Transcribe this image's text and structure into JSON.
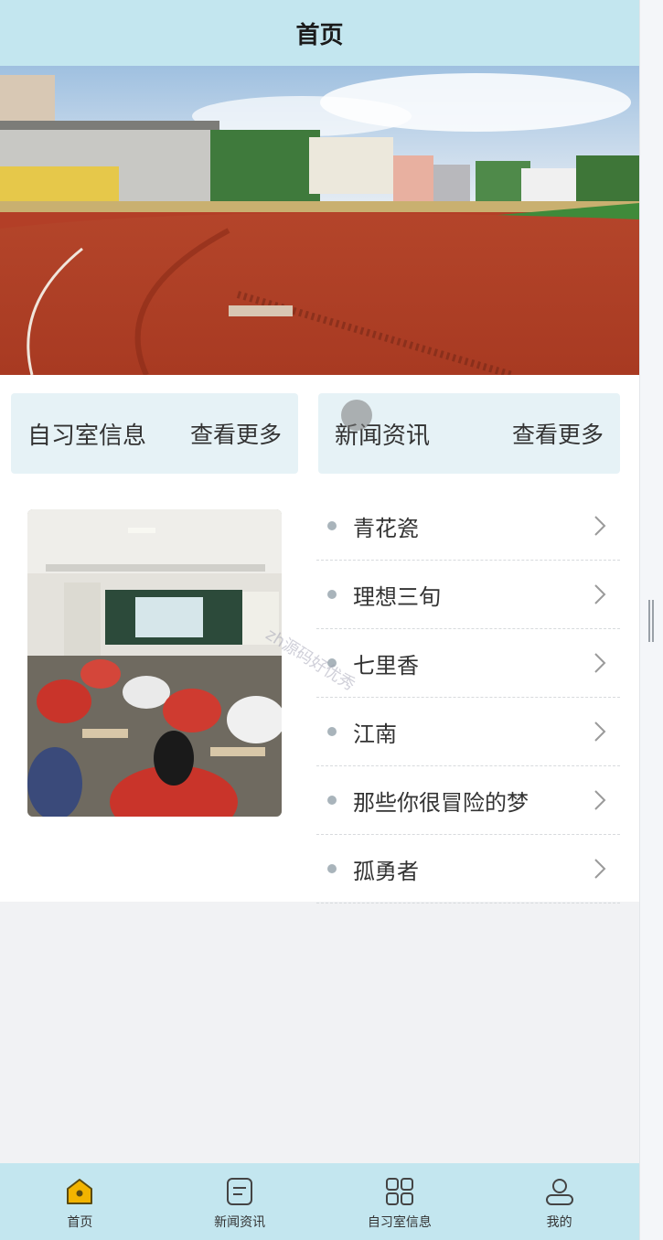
{
  "navbar": {
    "title": "首页"
  },
  "sections": {
    "study_room": {
      "title": "自习室信息",
      "more": "查看更多"
    },
    "news": {
      "title": "新闻资讯",
      "more": "查看更多"
    }
  },
  "news_items": [
    {
      "title": "青花瓷"
    },
    {
      "title": "理想三旬"
    },
    {
      "title": "七里香"
    },
    {
      "title": "江南"
    },
    {
      "title": "那些你很冒险的梦"
    },
    {
      "title": "孤勇者"
    }
  ],
  "watermark": "zh源码好优秀",
  "tabbar": {
    "items": [
      {
        "label": "首页",
        "icon": "home-icon",
        "active": true
      },
      {
        "label": "新闻资讯",
        "icon": "news-icon",
        "active": false
      },
      {
        "label": "自习室信息",
        "icon": "grid-icon",
        "active": false
      },
      {
        "label": "我的",
        "icon": "user-icon",
        "active": false
      }
    ]
  },
  "colors": {
    "header_bg": "#c3e6ef",
    "card_bg": "#e6f2f6",
    "active_icon": "#f2b400"
  }
}
